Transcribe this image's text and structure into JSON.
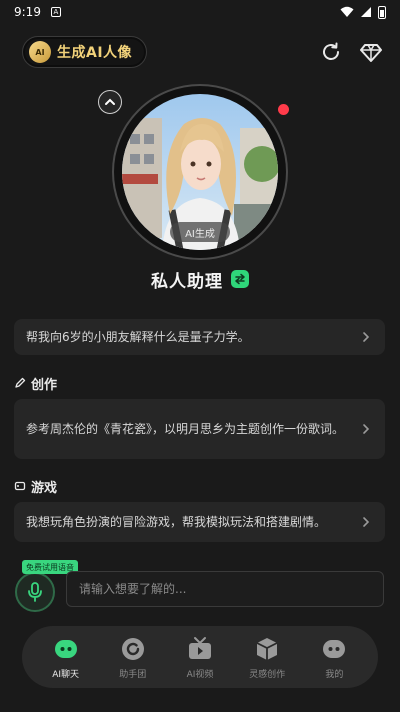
{
  "status": {
    "time": "9:19"
  },
  "header": {
    "generate_button": "生成AI人像",
    "badge": "AI"
  },
  "profile": {
    "ai_tag": "AI生成",
    "name": "私人助理"
  },
  "suggestion_top": "帮我向6岁的小朋友解释什么是量子力学。",
  "sections": [
    {
      "title": "创作",
      "icon": "pen-icon",
      "prompt": "参考周杰伦的《青花瓷》，以明月思乡为主题创作一份歌词。"
    },
    {
      "title": "游戏",
      "icon": "game-icon",
      "prompt": "我想玩角色扮演的冒险游戏，帮我模拟玩法和搭建剧情。"
    }
  ],
  "composer": {
    "free_tag": "免费试用语音",
    "placeholder": "请输入想要了解的..."
  },
  "tabs": [
    {
      "label": "AI聊天",
      "icon": "chat-bot-icon",
      "active": true
    },
    {
      "label": "助手团",
      "icon": "refresh-circle-icon",
      "active": false
    },
    {
      "label": "AI视频",
      "icon": "tv-icon",
      "active": false
    },
    {
      "label": "灵感创作",
      "icon": "cube-icon",
      "active": false
    },
    {
      "label": "我的",
      "icon": "robot-icon",
      "active": false
    }
  ],
  "colors": {
    "accent": "#39d67f",
    "gold": "#f2d27a",
    "background": "#1a1a1a",
    "card": "#262626",
    "alert": "#ff3b4a"
  }
}
